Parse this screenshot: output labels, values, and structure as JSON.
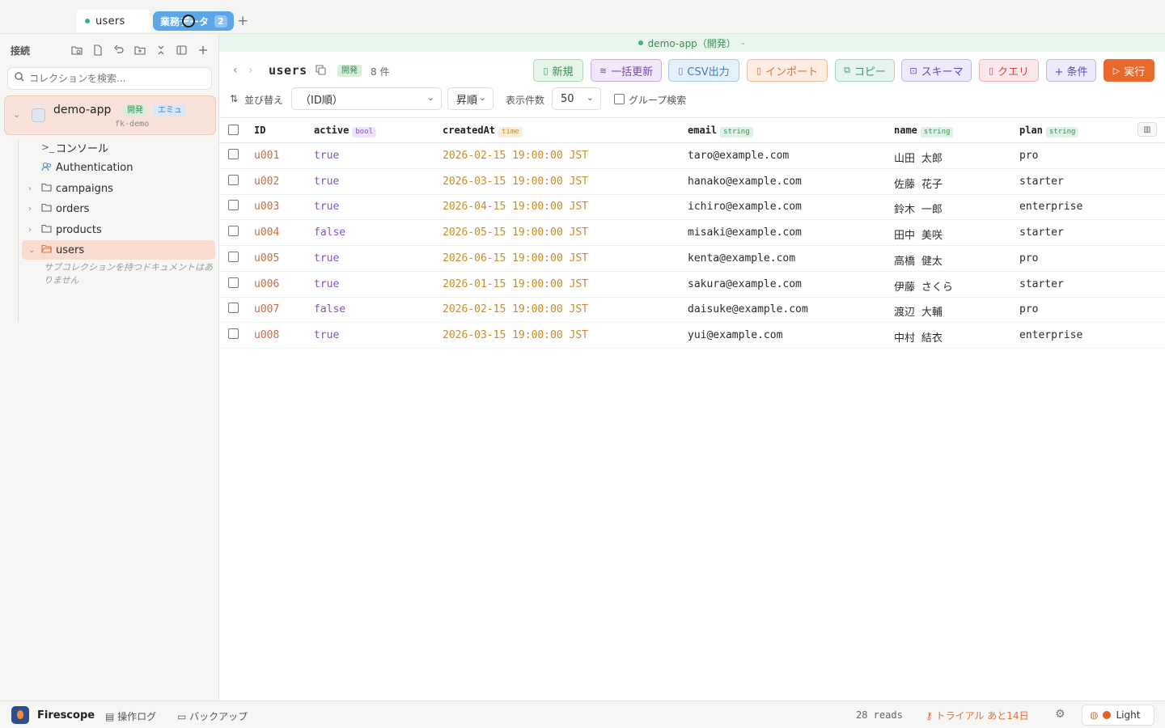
{
  "tabs": {
    "active_label": "users",
    "group_label": "業務データ",
    "group_count": "2",
    "add_label": "+"
  },
  "sidebar": {
    "heading": "接続",
    "search_placeholder": "コレクションを検索...",
    "connection": {
      "name": "demo-app",
      "badge_dev": "開発",
      "badge_emu": "エミュ",
      "project_id": "fk-demo"
    },
    "items": [
      {
        "label": "コンソール",
        "icon": "terminal-icon"
      },
      {
        "label": "Authentication",
        "icon": "users-icon"
      },
      {
        "label": "campaigns",
        "icon": "folder-icon"
      },
      {
        "label": "orders",
        "icon": "folder-icon"
      },
      {
        "label": "products",
        "icon": "folder-icon"
      },
      {
        "label": "users",
        "icon": "folder-open-icon"
      }
    ],
    "subcollection_note": "サブコレクションを持つドキュメントはありません"
  },
  "envbar": {
    "label": "demo-app（開発）"
  },
  "collection": {
    "title": "users",
    "env_badge": "開発",
    "count": "8 件"
  },
  "actions": {
    "new": "新規",
    "bulk_update": "一括更新",
    "csv_export": "CSV出力",
    "import": "インポート",
    "copy": "コピー",
    "schema": "スキーマ",
    "query": "クエリ",
    "condition": "+ 条件",
    "run": "実行"
  },
  "sort": {
    "label": "並び替え",
    "field_value": "（ID順）",
    "order_value": "昇順",
    "page_size_label": "表示件数",
    "page_size_value": "50",
    "group_search_label": "グループ検索"
  },
  "table": {
    "columns": [
      {
        "name": "ID",
        "type": ""
      },
      {
        "name": "active",
        "type": "bool"
      },
      {
        "name": "createdAt",
        "type": "time"
      },
      {
        "name": "email",
        "type": "string"
      },
      {
        "name": "name",
        "type": "string"
      },
      {
        "name": "plan",
        "type": "string"
      }
    ],
    "rows": [
      {
        "id": "u001",
        "active": "true",
        "createdAt": "2026-02-15 19:00:00 JST",
        "email": "taro@example.com",
        "name": "山田 太郎",
        "plan": "pro"
      },
      {
        "id": "u002",
        "active": "true",
        "createdAt": "2026-03-15 19:00:00 JST",
        "email": "hanako@example.com",
        "name": "佐藤 花子",
        "plan": "starter"
      },
      {
        "id": "u003",
        "active": "true",
        "createdAt": "2026-04-15 19:00:00 JST",
        "email": "ichiro@example.com",
        "name": "鈴木 一郎",
        "plan": "enterprise"
      },
      {
        "id": "u004",
        "active": "false",
        "createdAt": "2026-05-15 19:00:00 JST",
        "email": "misaki@example.com",
        "name": "田中 美咲",
        "plan": "starter"
      },
      {
        "id": "u005",
        "active": "true",
        "createdAt": "2026-06-15 19:00:00 JST",
        "email": "kenta@example.com",
        "name": "高橋 健太",
        "plan": "pro"
      },
      {
        "id": "u006",
        "active": "true",
        "createdAt": "2026-01-15 19:00:00 JST",
        "email": "sakura@example.com",
        "name": "伊藤 さくら",
        "plan": "starter"
      },
      {
        "id": "u007",
        "active": "false",
        "createdAt": "2026-02-15 19:00:00 JST",
        "email": "daisuke@example.com",
        "name": "渡辺 大輔",
        "plan": "pro"
      },
      {
        "id": "u008",
        "active": "true",
        "createdAt": "2026-03-15 19:00:00 JST",
        "email": "yui@example.com",
        "name": "中村 結衣",
        "plan": "enterprise"
      }
    ]
  },
  "footer": {
    "app_name": "Firescope",
    "op_log": "操作ログ",
    "backup": "バックアップ",
    "reads": "28 reads",
    "trial": "トライアル あと14日",
    "theme": "Light"
  },
  "colors": {
    "accent_orange": "#d9733f",
    "dev_green": "#3a8f55",
    "bool_purple": "#8a4fc9",
    "time_amber": "#cc8a2d",
    "run_button": "#e8692c"
  }
}
